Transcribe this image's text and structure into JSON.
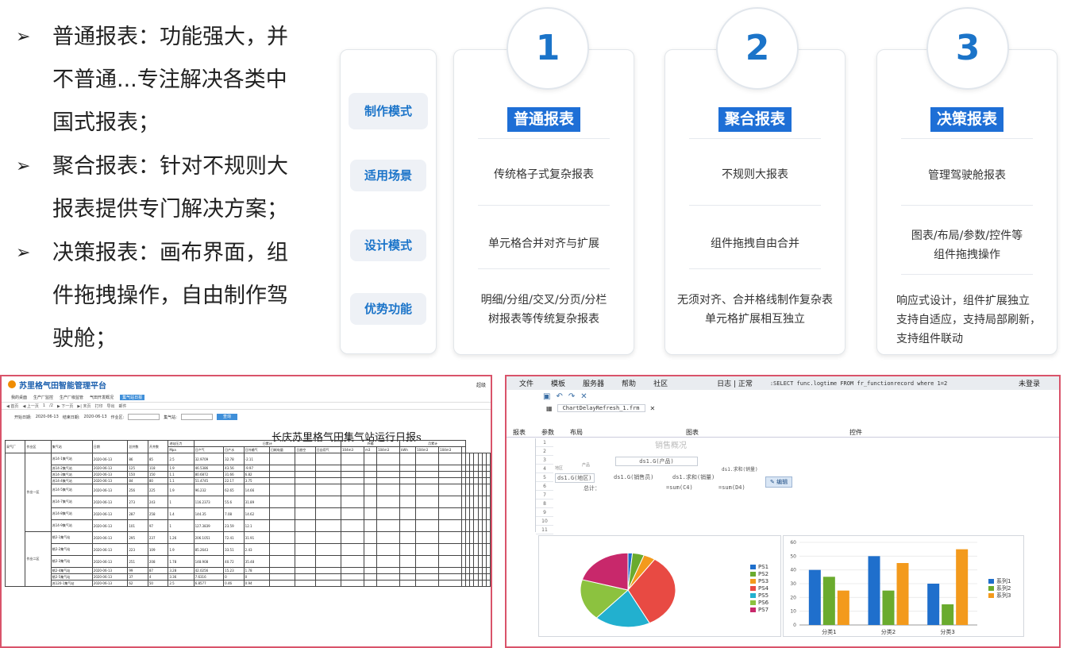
{
  "bullets": [
    {
      "l1": "普通报表：功能强大，并",
      "l2": "不普通...专注解决各类中",
      "l3": "国式报表；"
    },
    {
      "l1": "聚合报表：针对不规则大",
      "l2": "报表提供专门解决方案；"
    },
    {
      "l1": "决策报表：画布界面，组",
      "l2": "件拖拽操作，自由制作驾",
      "l3": "驶舱；"
    }
  ],
  "bullet_arrow": "➢",
  "side_labels": [
    "制作模式",
    "适用场景",
    "设计模式",
    "优势功能"
  ],
  "cards": [
    {
      "num": "1",
      "title": "普通报表",
      "scene": "传统格子式复杂报表",
      "design": "单元格合并对齐与扩展",
      "adv1": "明细/分组/交叉/分页/分栏",
      "adv2": "树报表等传统复杂报表"
    },
    {
      "num": "2",
      "title": "聚合报表",
      "scene": "不规则大报表",
      "design": "组件拖拽自由合并",
      "adv1": "无须对齐、合并格线制作复杂表",
      "adv2": "单元格扩展相互独立"
    },
    {
      "num": "3",
      "title": "决策报表",
      "scene": "管理驾驶舱报表",
      "design1": "图表/布局/参数/控件等",
      "design2": "组件拖拽操作",
      "adv1": "响应式设计，组件扩展独立",
      "adv2": "支持自适应，支持局部刷新，",
      "adv3": "支持组件联动"
    }
  ],
  "left_shot": {
    "app_title": "苏里格气田智能管理平台",
    "user": "超级",
    "menus": [
      "我的桌面",
      "生产厂监控",
      "生产厂级监管",
      "气田开发概况",
      "集气站日报"
    ],
    "active_menu": "集气站日报",
    "tools": [
      "◀ 首页",
      "◀ 上一页",
      "1",
      "/2",
      "▶ 下一页",
      "▶| 末页",
      "打印",
      "导出",
      "邮件"
    ],
    "filter_start_label": "开始日期:",
    "filter_start": "2020-06-13",
    "filter_end_label": "结束日期:",
    "filter_end": "2020-06-13",
    "filter_area_label": "作业区:",
    "filter_station_label": "集气站:",
    "query_btn": "查询",
    "report_title": "长庆苏里格气田集气站运行日报s",
    "col_headers": [
      "采气厂",
      "作业区",
      "集气站",
      "日期",
      "总井数",
      "开井数",
      "进站压力",
      "日产气",
      "日产水",
      "日外输气",
      "日耗电量",
      "日放空",
      "日自用气"
    ],
    "group_headers": [
      "日累计",
      "外输",
      "月累计"
    ],
    "units": [
      "Mpa",
      "104m3",
      "m3",
      "104m3",
      "kWh",
      "104m3",
      "104m3"
    ],
    "areas": [
      "作业一区",
      "作业二区"
    ],
    "rows": [
      {
        "station": "苏14-1集气站",
        "date": "2020-06-13",
        "wells": "86",
        "open": "85",
        "p": "2.5",
        "gas": "32.9709",
        "water": "32.78",
        "out": "-2.11"
      },
      {
        "station": "苏14-2集气站",
        "date": "2020-06-13",
        "wells": "125",
        "open": "118",
        "p": "1.9",
        "gas": "46.5386",
        "water": "43.56",
        "out": "-9.97"
      },
      {
        "station": "苏14-3集气站",
        "date": "2020-06-13",
        "wells": "150",
        "open": "150",
        "p": "1.1",
        "gas": "80.6872",
        "water": "31.66",
        "out": "6.82"
      },
      {
        "station": "苏14-4集气站",
        "date": "2020-06-13",
        "wells": "84",
        "open": "80",
        "p": "1.1",
        "gas": "51.4745",
        "water": "22.17",
        "out": "3.75"
      },
      {
        "station": "苏14-5集气站",
        "date": "2020-06-13",
        "wells": "256",
        "open": "225",
        "p": "1.9",
        "gas": "96.232",
        "water": "62.65",
        "out": "14.66"
      },
      {
        "station": "苏14-7集气站",
        "date": "2020-06-13",
        "wells": "273",
        "open": "243",
        "p": "1",
        "gas": "116.2373",
        "water": "55.6",
        "out": "31.89"
      },
      {
        "station": "苏14-8集气站",
        "date": "2020-06-13",
        "wells": "287",
        "open": "258",
        "p": "1.4",
        "gas": "144.35",
        "water": "7.08",
        "out": "14.62"
      },
      {
        "station": "苏14-9集气站",
        "date": "2020-06-13",
        "wells": "101",
        "open": "97",
        "p": "1",
        "gas": "127.3839",
        "water": "23.59",
        "out": "12.1"
      },
      {
        "station": "桃2-1集气站",
        "date": "2020-06-13",
        "wells": "295",
        "open": "237",
        "p": "1.26",
        "gas": "206.1051",
        "water": "72.41",
        "out": "31.91"
      },
      {
        "station": "桃2-2集气站",
        "date": "2020-06-13",
        "wells": "223",
        "open": "109",
        "p": "1.9",
        "gas": "85.2643",
        "water": "33.51",
        "out": "2.43"
      },
      {
        "station": "桃2-3集气站",
        "date": "2020-06-13",
        "wells": "251",
        "open": "208",
        "p": "1.78",
        "gas": "148.908",
        "water": "40.72",
        "out": "35.48"
      },
      {
        "station": "桃2-4集气站",
        "date": "2020-06-13",
        "wells": "99",
        "open": "87",
        "p": "3.28",
        "gas": "42.0256",
        "water": "15.23",
        "out": "1.78"
      },
      {
        "station": "桃2-5集气站",
        "date": "2020-06-13",
        "wells": "37",
        "open": "4",
        "p": "3.36",
        "gas": "7.6316",
        "water": "0",
        "out": "0"
      },
      {
        "station": "苏120-1集气站",
        "date": "2020-06-13",
        "wells": "62",
        "open": "50",
        "p": "2.5",
        "gas": "6.8577",
        "water": "0.46",
        "out": "0.94"
      }
    ]
  },
  "right_shot": {
    "menus": [
      "文件",
      "模板",
      "服务器",
      "帮助",
      "社区"
    ],
    "log": "日志 | 正常",
    "sql": ":SELECT func.logtime FROM fr_functionrecord where 1=2",
    "login": "未登录",
    "tab": "ChartDelayRefresh_1.frm",
    "ribbon": [
      "报表",
      "参数",
      "布局",
      "图表",
      "控件"
    ],
    "sheet_title": "销售概况",
    "cells": [
      "ds1.G(产品)",
      "ds1.G(地区)",
      "ds1.G(销售员)",
      "ds1.求和(销量)",
      "ds1.求和(销量)",
      "总计：",
      "=sum(C4)",
      "=sum(D4)"
    ],
    "corner_labels": [
      "地区",
      "产品",
      "销售员"
    ],
    "edit_btn": "编辑",
    "row_numbers": [
      "1",
      "2",
      "3",
      "4",
      "5",
      "6",
      "7",
      "8",
      "9",
      "10",
      "11"
    ],
    "chart_data": [
      {
        "type": "pie",
        "categories": [
          "PS1",
          "PS2",
          "PS3",
          "PS4",
          "PS5",
          "PS6",
          "PS7"
        ],
        "values": [
          1.5,
          4,
          4,
          33,
          19,
          18,
          20.5
        ],
        "colors": [
          "#1f6fcc",
          "#6aab2e",
          "#f39a1c",
          "#e84a43",
          "#22b0cf",
          "#8cc23f",
          "#c8286b"
        ]
      },
      {
        "type": "bar",
        "categories": [
          "分类1",
          "分类2",
          "分类3"
        ],
        "series": [
          {
            "name": "系列1",
            "values": [
              40,
              50,
              30
            ],
            "color": "#1f6fcc"
          },
          {
            "name": "系列2",
            "values": [
              35,
              25,
              15
            ],
            "color": "#6aab2e"
          },
          {
            "name": "系列3",
            "values": [
              25,
              45,
              55
            ],
            "color": "#f39a1c"
          }
        ],
        "ylim": [
          0,
          60
        ],
        "yticks": [
          "0",
          "10",
          "20",
          "30",
          "40",
          "50",
          "60"
        ]
      }
    ]
  }
}
